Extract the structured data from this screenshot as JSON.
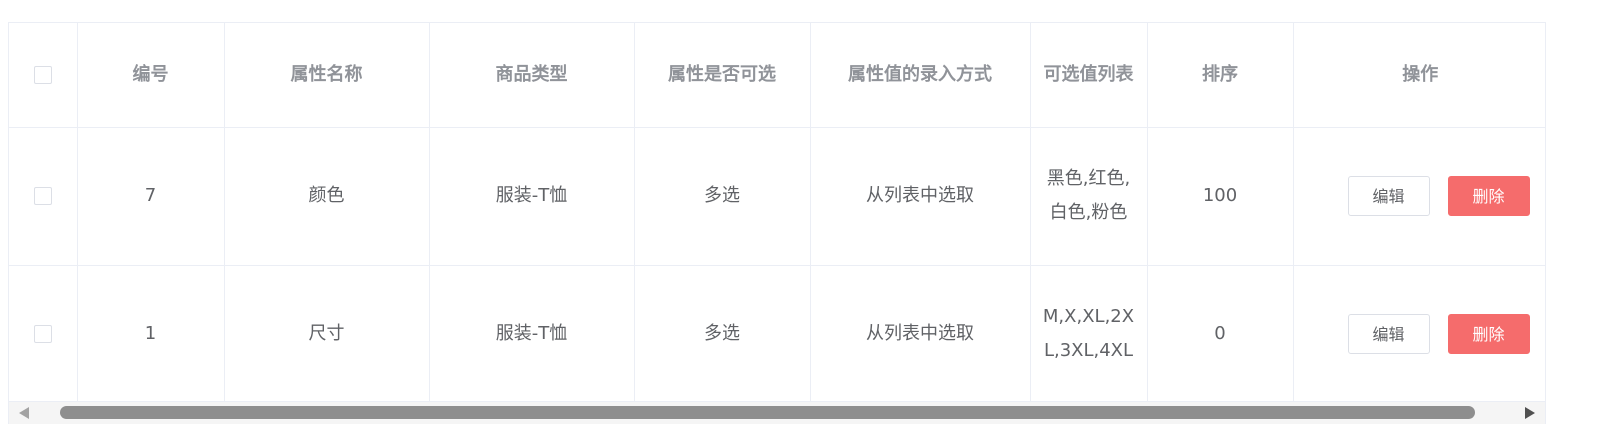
{
  "table": {
    "headers": [
      "编号",
      "属性名称",
      "商品类型",
      "属性是否可选",
      "属性值的录入方式",
      "可选值列表",
      "排序",
      "操作"
    ],
    "rows": [
      {
        "id": "7",
        "name": "颜色",
        "type": "服装-T恤",
        "selectable": "多选",
        "input_mode": "从列表中选取",
        "values": "黑色,红色,白色,粉色",
        "sort": "100"
      },
      {
        "id": "1",
        "name": "尺寸",
        "type": "服装-T恤",
        "selectable": "多选",
        "input_mode": "从列表中选取",
        "values": "M,X,XL,2XL,3XL,4XL",
        "sort": "0"
      }
    ],
    "actions": {
      "edit": "编辑",
      "delete": "删除"
    }
  },
  "colors": {
    "danger": "#f56c6c",
    "border": "#ebeef5",
    "header_text": "#909399"
  }
}
